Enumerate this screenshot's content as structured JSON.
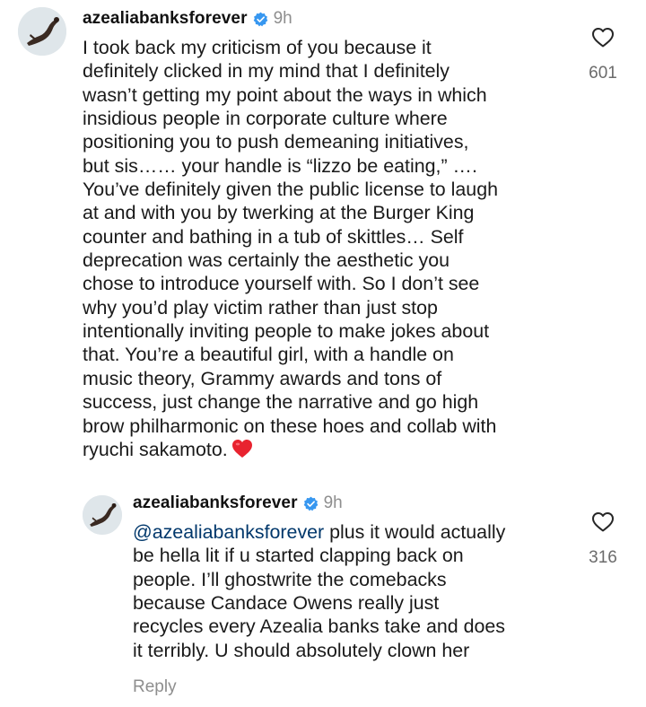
{
  "colors": {
    "text": "#1a1a1a",
    "muted": "#8e8e8e",
    "mention": "#00376b",
    "verified_badge": "#3797f0",
    "heart_emoji": "#e8232f"
  },
  "comments": [
    {
      "username": "azealiabanksforever",
      "verified_icon": "verified-badge-icon",
      "time": "9h",
      "lines": [
        "I took back my criticism of you because it",
        "definitely clicked in my mind that I definitely",
        "wasn’t getting my point about the ways in which",
        "insidious people in corporate culture where",
        "positioning you to push demeaning initiatives,",
        "but sis…… your handle is “lizzo be eating,” ….",
        "You’ve definitely given the public license to laugh",
        "at and with you by twerking at the Burger King",
        "counter and bathing in a tub of skittles… Self",
        "deprecation was certainly the aesthetic you",
        "chose to introduce yourself with. So I don’t see",
        "why you’d play victim rather than just stop",
        "intentionally inviting people to make jokes about",
        "that. You’re a beautiful girl, with a handle on",
        "music theory, Grammy awards and tons of",
        "success, just change the narrative and go high",
        "brow philharmonic on these hoes and collab with",
        "ryuchi sakamoto."
      ],
      "emoji": "heart-emoji",
      "like_icon": "heart-outline-icon",
      "likes": "601"
    },
    {
      "username": "azealiabanksforever",
      "verified_icon": "verified-badge-icon",
      "time": "9h",
      "mention": "@azealiabanksforever",
      "lines": [
        " plus it would actually",
        "be hella lit if u started clapping back on",
        "people. I’ll ghostwrite the comebacks",
        "because Candace Owens really just",
        "recycles every Azealia banks take and does",
        "it terribly. U should absolutely clown her"
      ],
      "like_icon": "heart-outline-icon",
      "likes": "316",
      "reply_label": "Reply"
    }
  ]
}
